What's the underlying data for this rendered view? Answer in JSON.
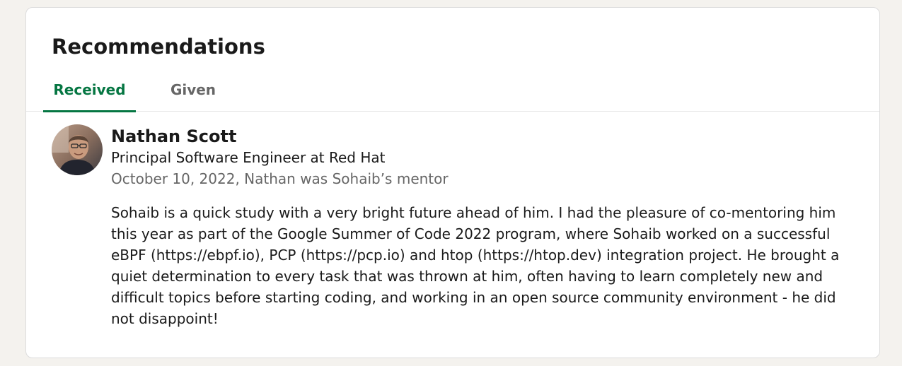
{
  "section": {
    "title": "Recommendations"
  },
  "tabs": [
    {
      "label": "Received",
      "active": true
    },
    {
      "label": "Given",
      "active": false
    }
  ],
  "colors": {
    "accent": "#057642",
    "muted": "#666666",
    "text": "#1a1a1a",
    "background": "#f4f2ee"
  },
  "recommendation": {
    "name": "Nathan Scott",
    "headline": "Principal Software Engineer at Red Hat",
    "meta": "October 10, 2022, Nathan was Sohaib’s mentor",
    "text": "Sohaib is a quick study with a very bright future ahead of him. I had the pleasure of co-mentoring him this year as part of the Google Summer of Code 2022 program, where Sohaib worked on a successful eBPF (https://ebpf.io), PCP (https://pcp.io) and htop (https://htop.dev) integration project. He brought a quiet determination to every task that was thrown at him, often having to learn completely new and difficult topics before starting coding, and working in an open source community environment - he did not disappoint!"
  }
}
